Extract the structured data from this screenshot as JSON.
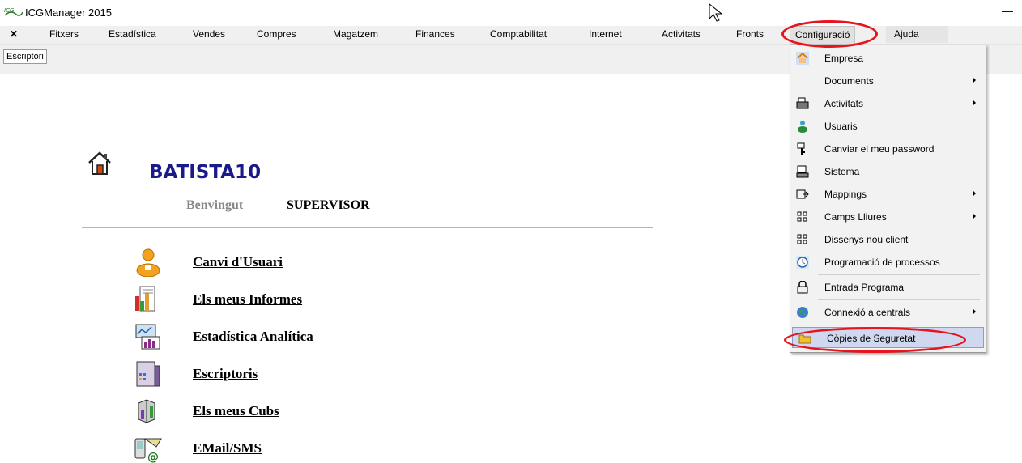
{
  "window": {
    "title": "ICGManager 2015",
    "minimize_glyph": "—"
  },
  "menubar": {
    "close_glyph": "✕",
    "items": [
      "Fitxers",
      "Estadística",
      "Vendes",
      "Compres",
      "Magatzem",
      "Finances",
      "Comptabilitat",
      "Internet",
      "Activitats",
      "Fronts",
      "Configuració",
      "Ajuda"
    ],
    "active": "Configuració"
  },
  "tabs": {
    "active": "Escriptori"
  },
  "main": {
    "company": "BATISTA10",
    "welcome_label": "Benvingut",
    "user": "SUPERVISOR",
    "links": [
      {
        "label": "Canvi d'Usuari",
        "icon": "user-icon"
      },
      {
        "label": "Els meus Informes",
        "icon": "reports-icon"
      },
      {
        "label": "Estadística Analítica ",
        "icon": "analytics-icon"
      },
      {
        "label": "Escriptoris",
        "icon": "desktops-icon"
      },
      {
        "label": "Els meus Cubs",
        "icon": "cubes-icon"
      },
      {
        "label": "EMail/SMS",
        "icon": "email-sms-icon"
      }
    ]
  },
  "dropdown": {
    "items": [
      {
        "label": "Empresa",
        "icon": "company-icon",
        "submenu": false
      },
      {
        "label": "Documents",
        "icon": "",
        "submenu": true
      },
      {
        "label": "Activitats",
        "icon": "activities-icon",
        "submenu": true
      },
      {
        "label": "Usuaris",
        "icon": "users-icon",
        "submenu": false
      },
      {
        "label": "Canviar el meu password",
        "icon": "key-icon",
        "submenu": false
      },
      {
        "label": "Sistema",
        "icon": "system-icon",
        "submenu": false
      },
      {
        "label": "Mappings",
        "icon": "mappings-icon",
        "submenu": true
      },
      {
        "label": "Camps Lliures",
        "icon": "grid-icon",
        "submenu": true
      },
      {
        "label": "Dissenys nou client",
        "icon": "grid-icon",
        "submenu": false
      },
      {
        "label": "Programació de processos",
        "icon": "clock-icon",
        "submenu": false
      },
      {
        "label": "Entrada Programa",
        "icon": "lock-icon",
        "submenu": false
      },
      {
        "label": "Connexió a centrals",
        "icon": "globe-icon",
        "submenu": true
      },
      {
        "label": "Còpies de Seguretat",
        "icon": "folder-icon",
        "submenu": false
      }
    ],
    "highlighted": "Còpies de Seguretat"
  },
  "colors": {
    "annotation": "#e8141c",
    "company_title": "#1a1a8a",
    "highlight": "#cfd8ef"
  }
}
